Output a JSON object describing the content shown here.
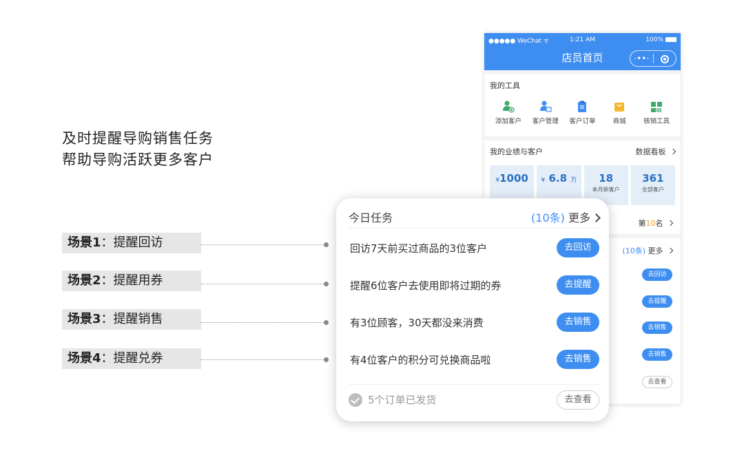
{
  "headline": {
    "line1": "及时提醒导购销售任务",
    "line2": "帮助导购活跃更多客户"
  },
  "scenes": [
    {
      "tag": "场景1",
      "sep": "：",
      "name": "提醒回访"
    },
    {
      "tag": "场景2",
      "sep": "：",
      "name": "提醒用券"
    },
    {
      "tag": "场景3",
      "sep": "：",
      "name": "提醒销售"
    },
    {
      "tag": "场景4",
      "sep": "：",
      "name": "提醒兑券"
    }
  ],
  "phone": {
    "status": {
      "carrier": "●●●●● WeChat ᯤ",
      "time": "1:21 AM",
      "battery": "100%"
    },
    "nav_title": "店员首页",
    "capsule": {
      "menu": "·••·"
    },
    "tools": {
      "title": "我的工具",
      "items": [
        {
          "label": "添加客户",
          "icon": "add-user-icon"
        },
        {
          "label": "客户管理",
          "icon": "manage-users-icon"
        },
        {
          "label": "客户订单",
          "icon": "order-clipboard-icon"
        },
        {
          "label": "商城",
          "icon": "shop-bag-icon"
        },
        {
          "label": "核销工具",
          "icon": "barcode-icon"
        }
      ]
    },
    "perf": {
      "title": "我的业绩与客户",
      "more": "数据看板",
      "stats": [
        {
          "prefix": "¥",
          "value": "1000",
          "unit": "",
          "label": ""
        },
        {
          "prefix": "¥",
          "value": "6.8",
          "unit": "万",
          "label": ""
        },
        {
          "prefix": "",
          "value": "18",
          "unit": "",
          "label": "本月新客户"
        },
        {
          "prefix": "",
          "value": "361",
          "unit": "",
          "label": "全部客户"
        }
      ],
      "rank_prefix": "第",
      "rank_value": "10",
      "rank_suffix": "名"
    },
    "tasks": {
      "count": "(10条)",
      "more": "更多",
      "buttons": [
        "去回访",
        "去提醒",
        "去销售",
        "去销售",
        "去查看"
      ]
    }
  },
  "card": {
    "title": "今日任务",
    "count": "(10条)",
    "more": "更多",
    "tasks": [
      {
        "text": "回访7天前买过商品的3位客户",
        "button": "去回访"
      },
      {
        "text": "提醒6位客户去使用即将过期的券",
        "button": "去提醒"
      },
      {
        "text": "有3位顾客，30天都没来消费",
        "button": "去销售"
      },
      {
        "text": "有4位客户的积分可兑换商品啦",
        "button": "去销售"
      }
    ],
    "footer": {
      "text": "5个订单已发货",
      "button": "去查看"
    }
  },
  "colors": {
    "primary": "#3d8ef0",
    "accent": "#f0a020",
    "label_bg": "#e6e6e6"
  }
}
